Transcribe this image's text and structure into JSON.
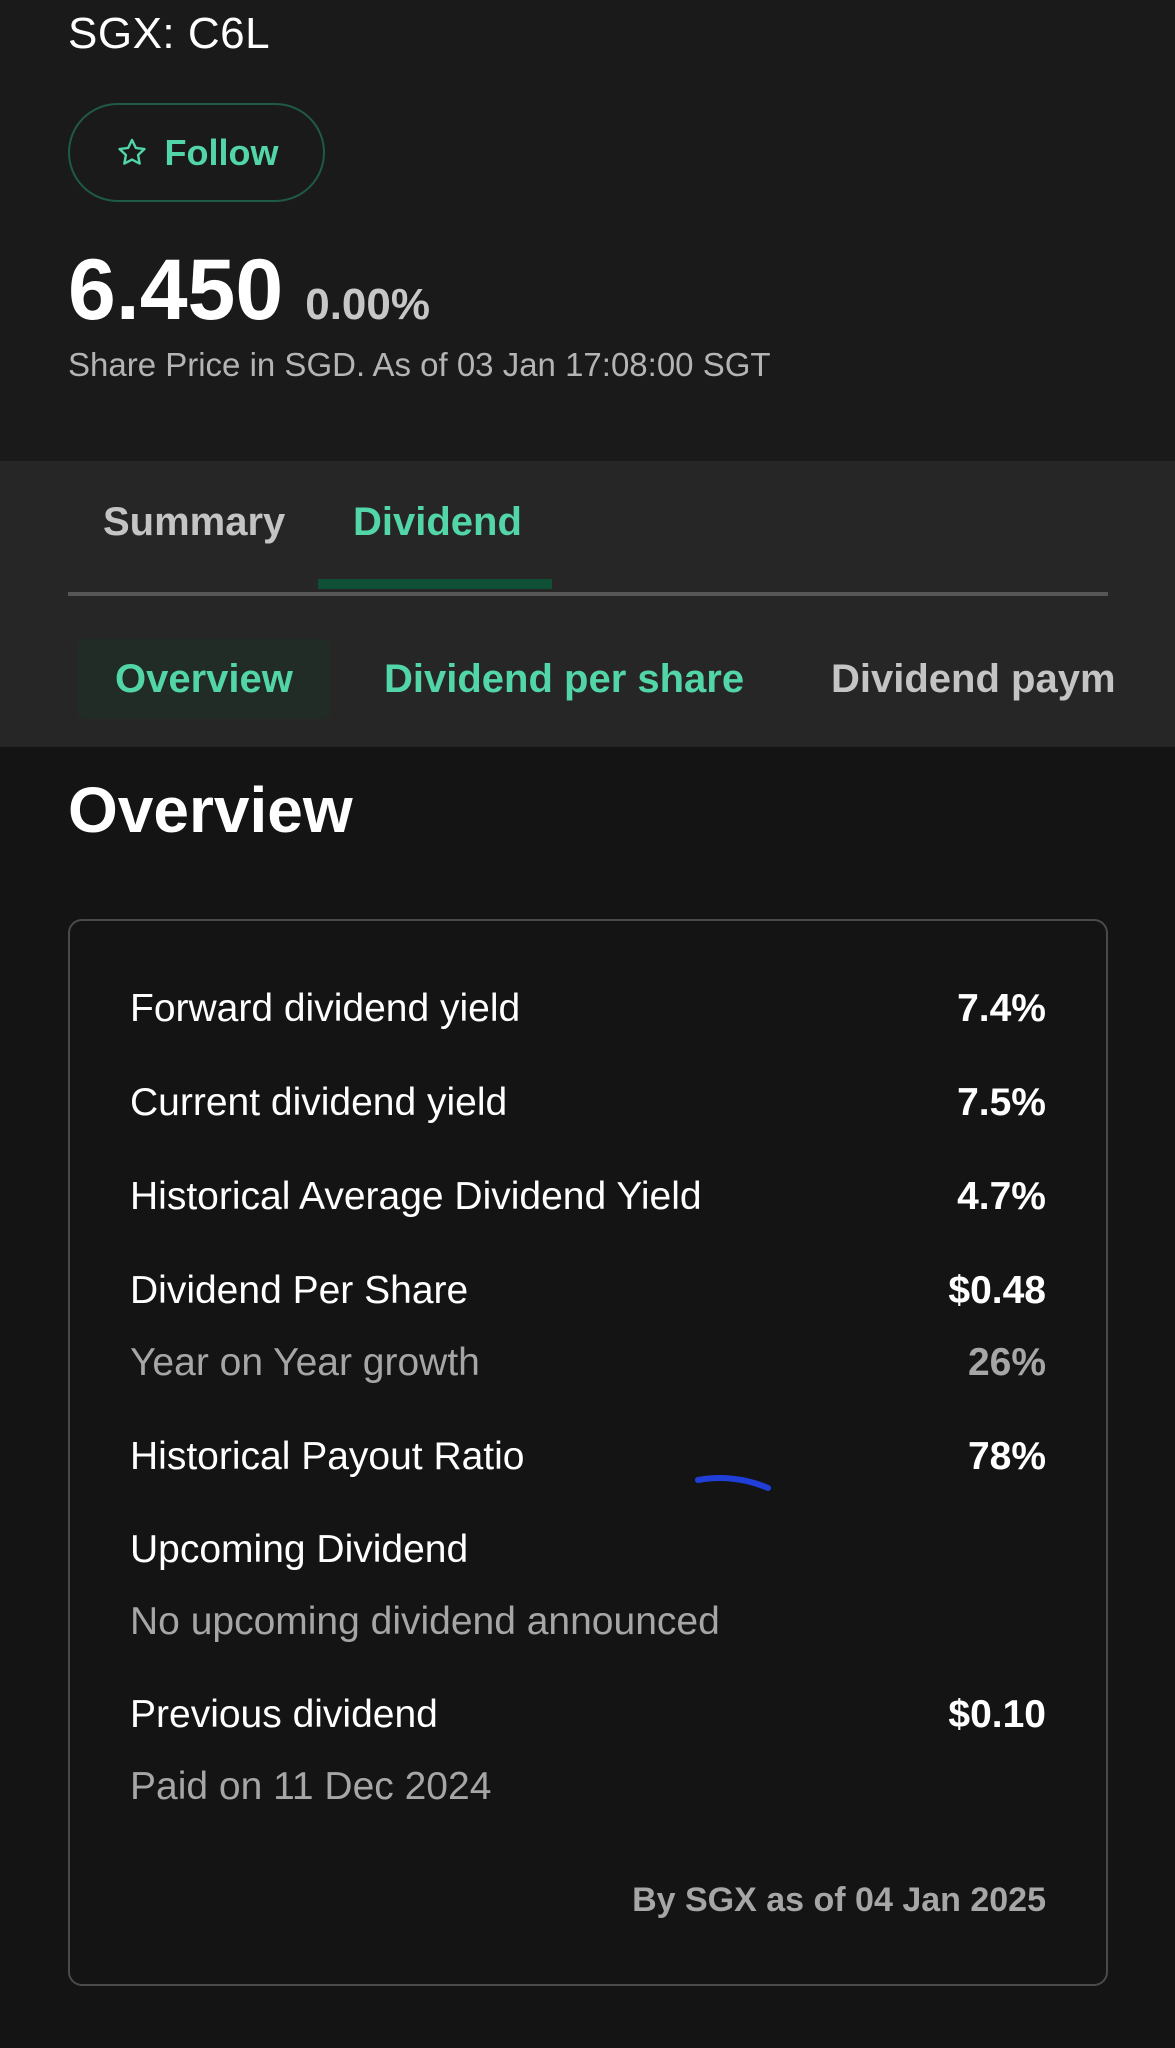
{
  "header": {
    "ticker": "SGX: C6L",
    "follow_label": "Follow",
    "price": "6.450",
    "change": "0.00%",
    "price_note": "Share Price in SGD. As of 03 Jan 17:08:00 SGT"
  },
  "tabs": {
    "items": [
      {
        "label": "Summary",
        "active": false
      },
      {
        "label": "Dividend",
        "active": true
      }
    ]
  },
  "subtabs": {
    "items": [
      {
        "label": "Overview",
        "active": true
      },
      {
        "label": "Dividend per share",
        "active": false
      },
      {
        "label": "Dividend paym",
        "active": false
      }
    ]
  },
  "overview": {
    "title": "Overview",
    "rows": {
      "forward_yield": {
        "label": "Forward dividend yield",
        "value": "7.4%"
      },
      "current_yield": {
        "label": "Current dividend yield",
        "value": "7.5%"
      },
      "historical_avg_yield": {
        "label": "Historical Average Dividend Yield",
        "value": "4.7%"
      },
      "dps": {
        "label": "Dividend Per Share",
        "value": "$0.48"
      },
      "yoy_growth": {
        "label": "Year on Year growth",
        "value": "26%"
      },
      "payout_ratio": {
        "label": "Historical Payout Ratio",
        "value": "78%"
      },
      "upcoming": {
        "label": "Upcoming Dividend"
      },
      "upcoming_note": {
        "label": "No upcoming dividend announced"
      },
      "previous": {
        "label": "Previous dividend",
        "value": "$0.10"
      },
      "previous_paid": {
        "label": "Paid on 11 Dec 2024"
      }
    },
    "source_note": "By SGX as of 04 Jan 2025"
  },
  "colors": {
    "accent": "#52d6a8",
    "background": "#141414",
    "header_bg": "#1a1a1a",
    "tab_bg": "#262626",
    "annotation": "#1f3fd8"
  }
}
